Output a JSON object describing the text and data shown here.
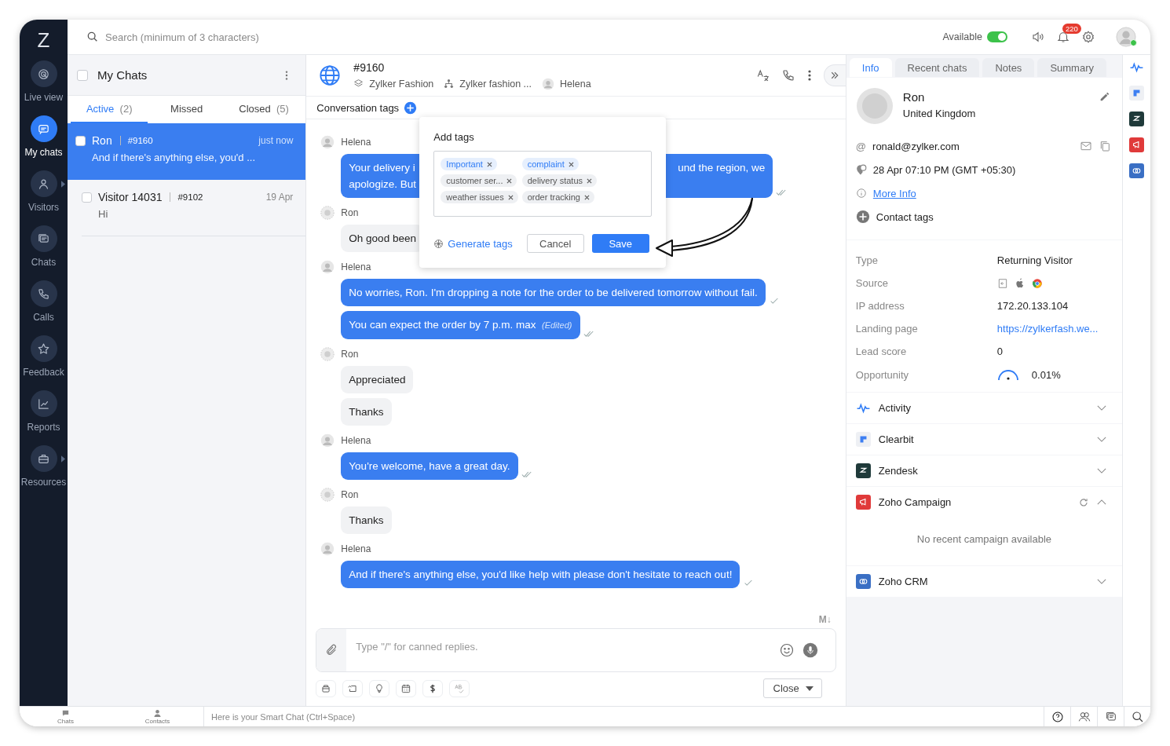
{
  "nav": [
    {
      "label": "Live view",
      "selected": false,
      "submenu": false
    },
    {
      "label": "My chats",
      "selected": true,
      "submenu": false
    },
    {
      "label": "Visitors",
      "selected": false,
      "submenu": true
    },
    {
      "label": "Chats",
      "selected": false,
      "submenu": false
    },
    {
      "label": "Calls",
      "selected": false,
      "submenu": false
    },
    {
      "label": "Feedback",
      "selected": false,
      "submenu": false
    },
    {
      "label": "Reports",
      "selected": false,
      "submenu": false
    },
    {
      "label": "Resources",
      "selected": false,
      "submenu": true
    }
  ],
  "logo": "Z",
  "search": {
    "placeholder": "Search (minimum of 3 characters)"
  },
  "topbar": {
    "status_label": "Available",
    "status_on": true,
    "notification_count": "220"
  },
  "chat_list": {
    "title": "My Chats",
    "select_all_checked": false,
    "tabs": [
      {
        "label": "Active",
        "count": "(2)",
        "selected": true
      },
      {
        "label": "Missed",
        "selected": false
      },
      {
        "label": "Closed",
        "count": "(5)",
        "selected": false
      }
    ],
    "items": [
      {
        "name": "Ron",
        "id": "#9160",
        "time": "just now",
        "preview": "And if there's anything else, you'd ...",
        "selected": true,
        "checked": false
      },
      {
        "name": "Visitor 14031",
        "id": "#9102",
        "time": "19 Apr",
        "preview": "Hi",
        "selected": false,
        "checked": false
      }
    ]
  },
  "conversation": {
    "id": "#9160",
    "department": "Zylker Fashion",
    "portal": "Zylker fashion ...",
    "agent": "Helena",
    "tags_label": "Conversation tags",
    "groups": [
      {
        "sender": "Helena",
        "kind": "operator",
        "bubbles": [
          {
            "text_left": "Your delivery i\napologize. But",
            "text_right": "und the region, we",
            "read": true
          }
        ]
      },
      {
        "sender": "Ron",
        "kind": "visitor",
        "bubbles": [
          {
            "text": "Oh good been"
          }
        ]
      },
      {
        "sender": "Helena",
        "kind": "operator",
        "bubbles": [
          {
            "text": "No worries, Ron. I'm dropping a note for the order to be delivered tomorrow without fail.",
            "read": false
          },
          {
            "text": "You can expect the order by 7 p.m. max",
            "edited": "(Edited)",
            "read": true
          }
        ]
      },
      {
        "sender": "Ron",
        "kind": "visitor",
        "bubbles": [
          {
            "text": "Appreciated"
          },
          {
            "text": "Thanks"
          }
        ]
      },
      {
        "sender": "Helena",
        "kind": "operator",
        "bubbles": [
          {
            "text": "You're welcome, have a great day.",
            "read": true
          }
        ]
      },
      {
        "sender": "Ron",
        "kind": "visitor",
        "bubbles": [
          {
            "text": "Thanks"
          }
        ]
      },
      {
        "sender": "Helena",
        "kind": "operator",
        "bubbles": [
          {
            "text": "And if there's anything else, you'd like help with please don't hesitate to reach out!",
            "read": false
          }
        ]
      }
    ],
    "markdown_badge": "M↓",
    "composer_placeholder": "Type \"/\" for canned replies.",
    "close_button": "Close"
  },
  "tag_popup": {
    "title": "Add tags",
    "tags": [
      {
        "label": "Important",
        "highlighted": true
      },
      {
        "label": "complaint",
        "highlighted": true
      },
      {
        "label": "customer ser...",
        "highlighted": false
      },
      {
        "label": "delivery status",
        "highlighted": false
      },
      {
        "label": "weather issues",
        "highlighted": false
      },
      {
        "label": "order tracking",
        "highlighted": false
      }
    ],
    "generate_label": "Generate tags",
    "cancel": "Cancel",
    "save": "Save"
  },
  "info_panel": {
    "tabs": [
      {
        "label": "Info",
        "selected": true
      },
      {
        "label": "Recent chats",
        "selected": false
      },
      {
        "label": "Notes",
        "selected": false
      },
      {
        "label": "Summary",
        "selected": false
      }
    ],
    "contact": {
      "name": "Ron",
      "country": "United Kingdom",
      "email_symbol": "@",
      "email": "ronald@zylker.com",
      "local_time": "28 Apr 07:10 PM  (GMT +05:30)",
      "more_info": "More Info",
      "contact_tags": "Contact tags"
    },
    "details": [
      {
        "label": "Type",
        "kind": "text",
        "value": "Returning Visitor"
      },
      {
        "label": "Source",
        "kind": "icons"
      },
      {
        "label": "IP address",
        "kind": "text",
        "value": "172.20.133.104"
      },
      {
        "label": "Landing page",
        "kind": "link",
        "value": "https://zylkerfash.we..."
      },
      {
        "label": "Lead score",
        "kind": "text",
        "value": "0"
      },
      {
        "label": "Opportunity",
        "kind": "gauge",
        "value": "0.01%"
      }
    ],
    "integrations": [
      {
        "name": "Activity",
        "expanded": false
      },
      {
        "name": "Clearbit",
        "expanded": false
      },
      {
        "name": "Zendesk",
        "expanded": false
      },
      {
        "name": "Zoho Campaign",
        "expanded": true,
        "empty_text": "No recent campaign available"
      },
      {
        "name": "Zoho CRM",
        "expanded": false
      }
    ]
  },
  "bottom_bar": {
    "tabs": [
      {
        "label": "Chats"
      },
      {
        "label": "Contacts"
      }
    ],
    "smart_chat": "Here is your Smart Chat (Ctrl+Space)"
  }
}
